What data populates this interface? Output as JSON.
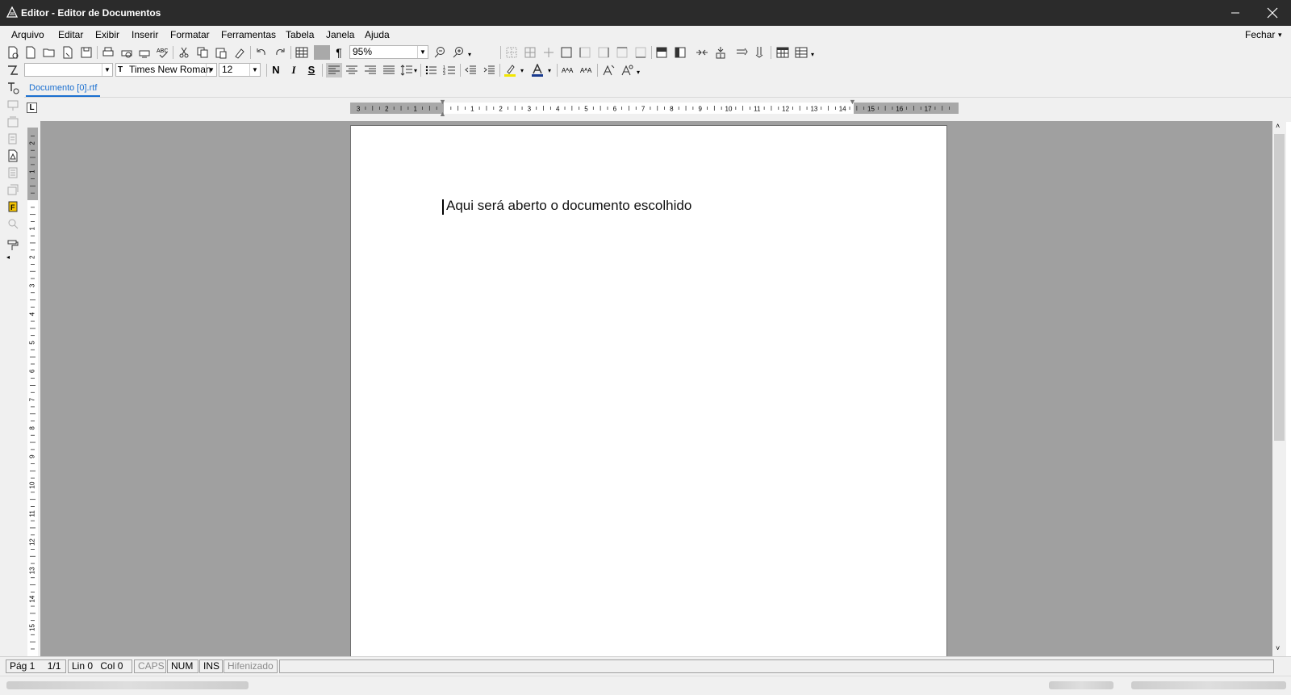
{
  "window": {
    "title": "Editor - Editor de Documentos"
  },
  "menu": {
    "items": [
      {
        "label": "Arquivo"
      },
      {
        "label": "Editar"
      },
      {
        "label": "Exibir"
      },
      {
        "label": "Inserir"
      },
      {
        "label": "Formatar"
      },
      {
        "label": "Ferramentas"
      },
      {
        "label": "Tabela"
      },
      {
        "label": "Janela"
      },
      {
        "label": "Ajuda"
      }
    ],
    "close_label": "Fechar"
  },
  "toolbar": {
    "zoom_value": "95%",
    "font_name": "Times New Roman",
    "font_size": "12",
    "bold_label": "N",
    "italic_label": "I",
    "underline_label": "S",
    "pilcrow": "¶"
  },
  "tabs": {
    "document": "Documento [0].rtf"
  },
  "ruler": {
    "h_labels": [
      "3",
      "2",
      "1",
      "1",
      "2",
      "3",
      "4",
      "5",
      "6",
      "7",
      "8",
      "9",
      "10",
      "11",
      "12",
      "13",
      "14",
      "15",
      "16",
      "17"
    ],
    "v_labels": [
      "2",
      "1",
      "1",
      "2",
      "3",
      "4",
      "5",
      "6",
      "7",
      "8",
      "9",
      "10",
      "11",
      "12",
      "13",
      "14",
      "15"
    ]
  },
  "document": {
    "text": "Aqui será aberto o documento escolhido"
  },
  "status": {
    "page": "Pág 1",
    "pages": "1/1",
    "line": "Lin 0",
    "col": "Col 0",
    "caps": "CAPS",
    "num": "NUM",
    "ins": "INS",
    "hyphen": "Hifenizado"
  }
}
